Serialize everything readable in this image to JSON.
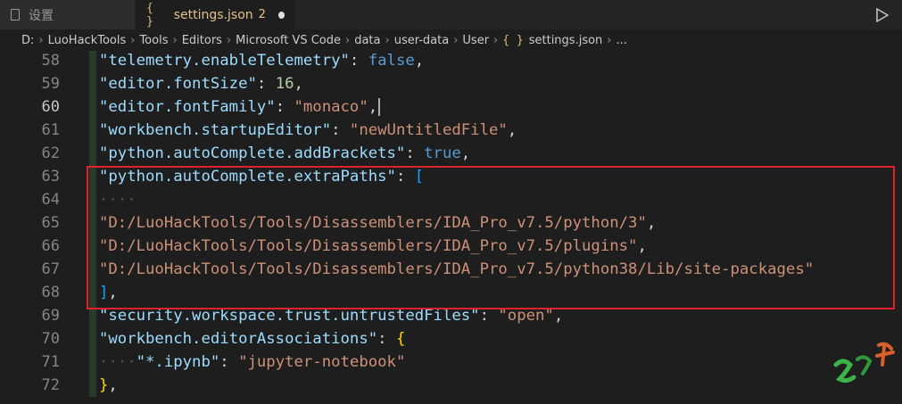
{
  "tabs": [
    {
      "label": "设置",
      "icon": "file-icon"
    },
    {
      "label": "settings.json",
      "icon": "json-braces-icon",
      "badge": "2",
      "dirty": true
    }
  ],
  "breadcrumb": [
    "D:",
    "LuoHackTools",
    "Tools",
    "Editors",
    "Microsoft VS Code",
    "data",
    "user-data",
    "User"
  ],
  "breadcrumb_file": "settings.json",
  "breadcrumb_more": "...",
  "lines": {
    "58": {
      "n": "58",
      "key": "\"telemetry.enableTelemetry\"",
      "val": "false"
    },
    "59": {
      "n": "59",
      "key": "\"editor.fontSize\"",
      "val": "16"
    },
    "60": {
      "n": "60",
      "key": "\"editor.fontFamily\"",
      "val": "\"monaco\""
    },
    "61": {
      "n": "61",
      "key": "\"workbench.startupEditor\"",
      "val": "\"newUntitledFile\""
    },
    "62": {
      "n": "62",
      "key": "\"python.autoComplete.addBrackets\"",
      "val": "true"
    },
    "63": {
      "n": "63",
      "key": "\"python.autoComplete.extraPaths\"",
      "val": "["
    },
    "64": {
      "n": "64",
      "dots": "····"
    },
    "65": {
      "n": "65",
      "val": "\"D:/LuoHackTools/Tools/Disassemblers/IDA_Pro_v7.5/python/3\""
    },
    "66": {
      "n": "66",
      "val": "\"D:/LuoHackTools/Tools/Disassemblers/IDA_Pro_v7.5/plugins\""
    },
    "67": {
      "n": "67",
      "val": "\"D:/LuoHackTools/Tools/Disassemblers/IDA_Pro_v7.5/python38/Lib/site-packages\""
    },
    "68": {
      "n": "68",
      "val": "]"
    },
    "69": {
      "n": "69",
      "key": "\"security.workspace.trust.untrustedFiles\"",
      "val": "\"open\""
    },
    "70": {
      "n": "70",
      "key": "\"workbench.editorAssociations\"",
      "val": "{"
    },
    "71": {
      "n": "71",
      "dots": "····",
      "key": "\"*.ipynb\"",
      "val": "\"jupyter-notebook\""
    },
    "72": {
      "n": "72",
      "val": "}"
    }
  },
  "colors": {
    "key": "#9cdcfe",
    "string": "#ce9178",
    "number": "#b5cea8",
    "keyword": "#569cd6",
    "highlight_box": "#e0202a"
  }
}
